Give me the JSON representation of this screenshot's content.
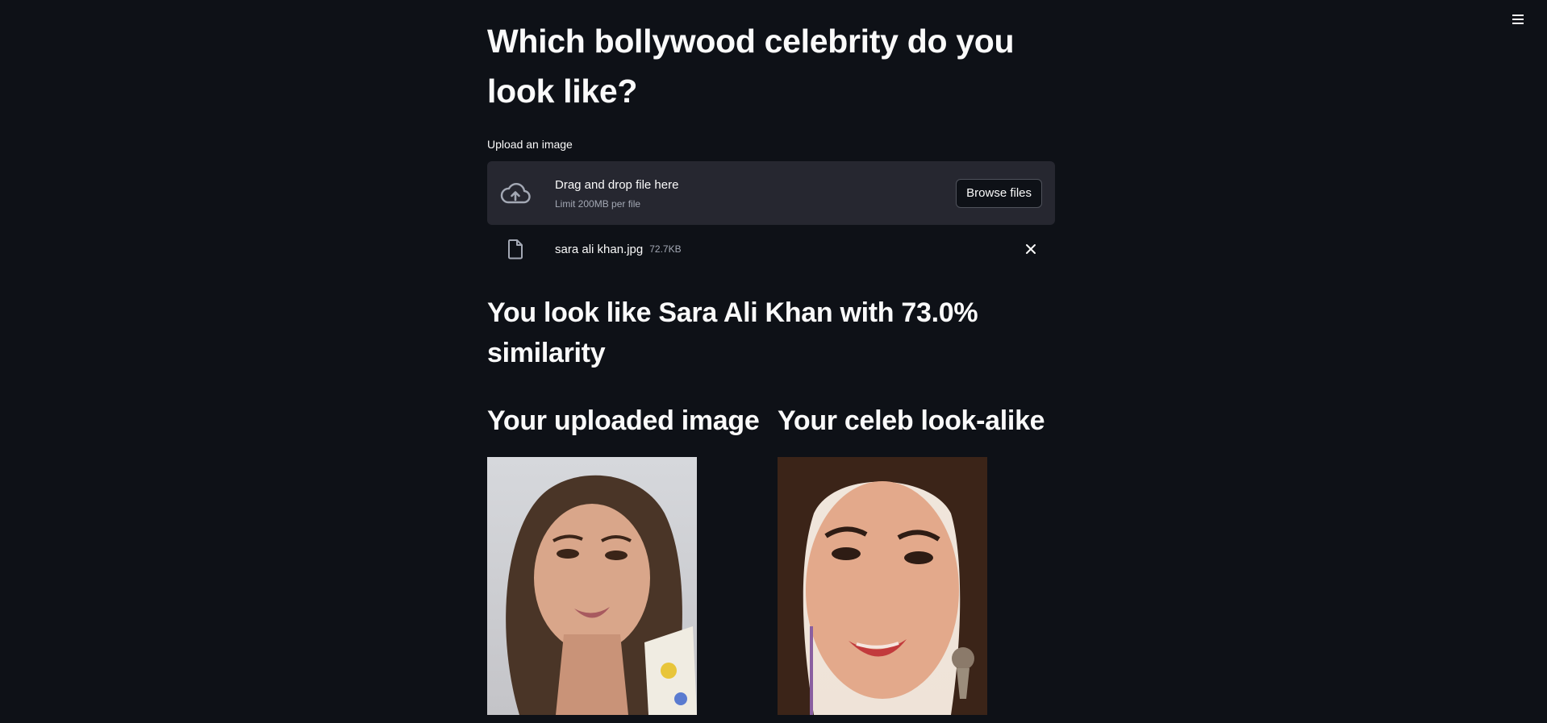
{
  "app": {
    "title": "Which bollywood celebrity do you look like?",
    "menu_icon": "hamburger-menu-icon"
  },
  "uploader": {
    "label": "Upload an image",
    "drop_title": "Drag and drop file here",
    "drop_limit": "Limit 200MB per file",
    "browse_label": "Browse files",
    "icon": "cloud-upload-icon"
  },
  "file": {
    "name": "sara ali khan.jpg",
    "size": "72.7KB",
    "icon": "file-icon",
    "remove_icon": "close-icon"
  },
  "result": {
    "text": "You look like Sara Ali Khan with 73.0% similarity",
    "uploaded_heading": "Your uploaded image",
    "celeb_heading": "Your celeb look-alike"
  },
  "colors": {
    "background": "#0e1117",
    "dropzone": "#262730",
    "text": "#fafafa",
    "muted": "#a3a8b4"
  }
}
